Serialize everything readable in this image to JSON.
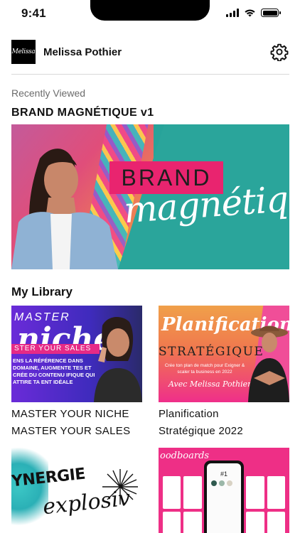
{
  "status_bar": {
    "time": "9:41"
  },
  "header": {
    "avatar_text": "Melissa",
    "user_name": "Melissa Pothier",
    "settings_icon": "gear-icon"
  },
  "recently_viewed": {
    "caption": "Recently Viewed",
    "title": "BRAND MAGNÉTIQUE v1",
    "banner": {
      "word1": "BRAND",
      "word2": "magnétique"
    }
  },
  "library": {
    "title": "My Library",
    "items": [
      {
        "title_line1": "MASTER YOUR NICHE",
        "title_line2": "MASTER YOUR SALES",
        "thumb": {
          "line1": "MASTER",
          "line2": "niche",
          "bar": "STER YOUR SALES",
          "body": "ENS LA RÉFÉRENCE DANS DOMAINE, AUGMENTE TES ET CRÉE DU CONTENU IFIQUE QUI ATTIRE TA ENT IDÉALE"
        }
      },
      {
        "title_line1": "Planification",
        "title_line2": "Stratégique 2022",
        "thumb": {
          "line1": "Planification",
          "line2": "STRATÉGIQUE",
          "sub": "Crée ton plan de match pour Exigner & scaler ta business en 2022",
          "signature": "Avec Melissa Pothier"
        }
      },
      {
        "thumb": {
          "line1": "YNERGIE",
          "line2": "explosiv"
        }
      },
      {
        "thumb": {
          "line1": "oodboards",
          "phone_label": "#1"
        }
      }
    ]
  },
  "colors": {
    "accent_pink": "#e9246f",
    "teal": "#2aa59b",
    "purple": "#6a2bd8"
  }
}
